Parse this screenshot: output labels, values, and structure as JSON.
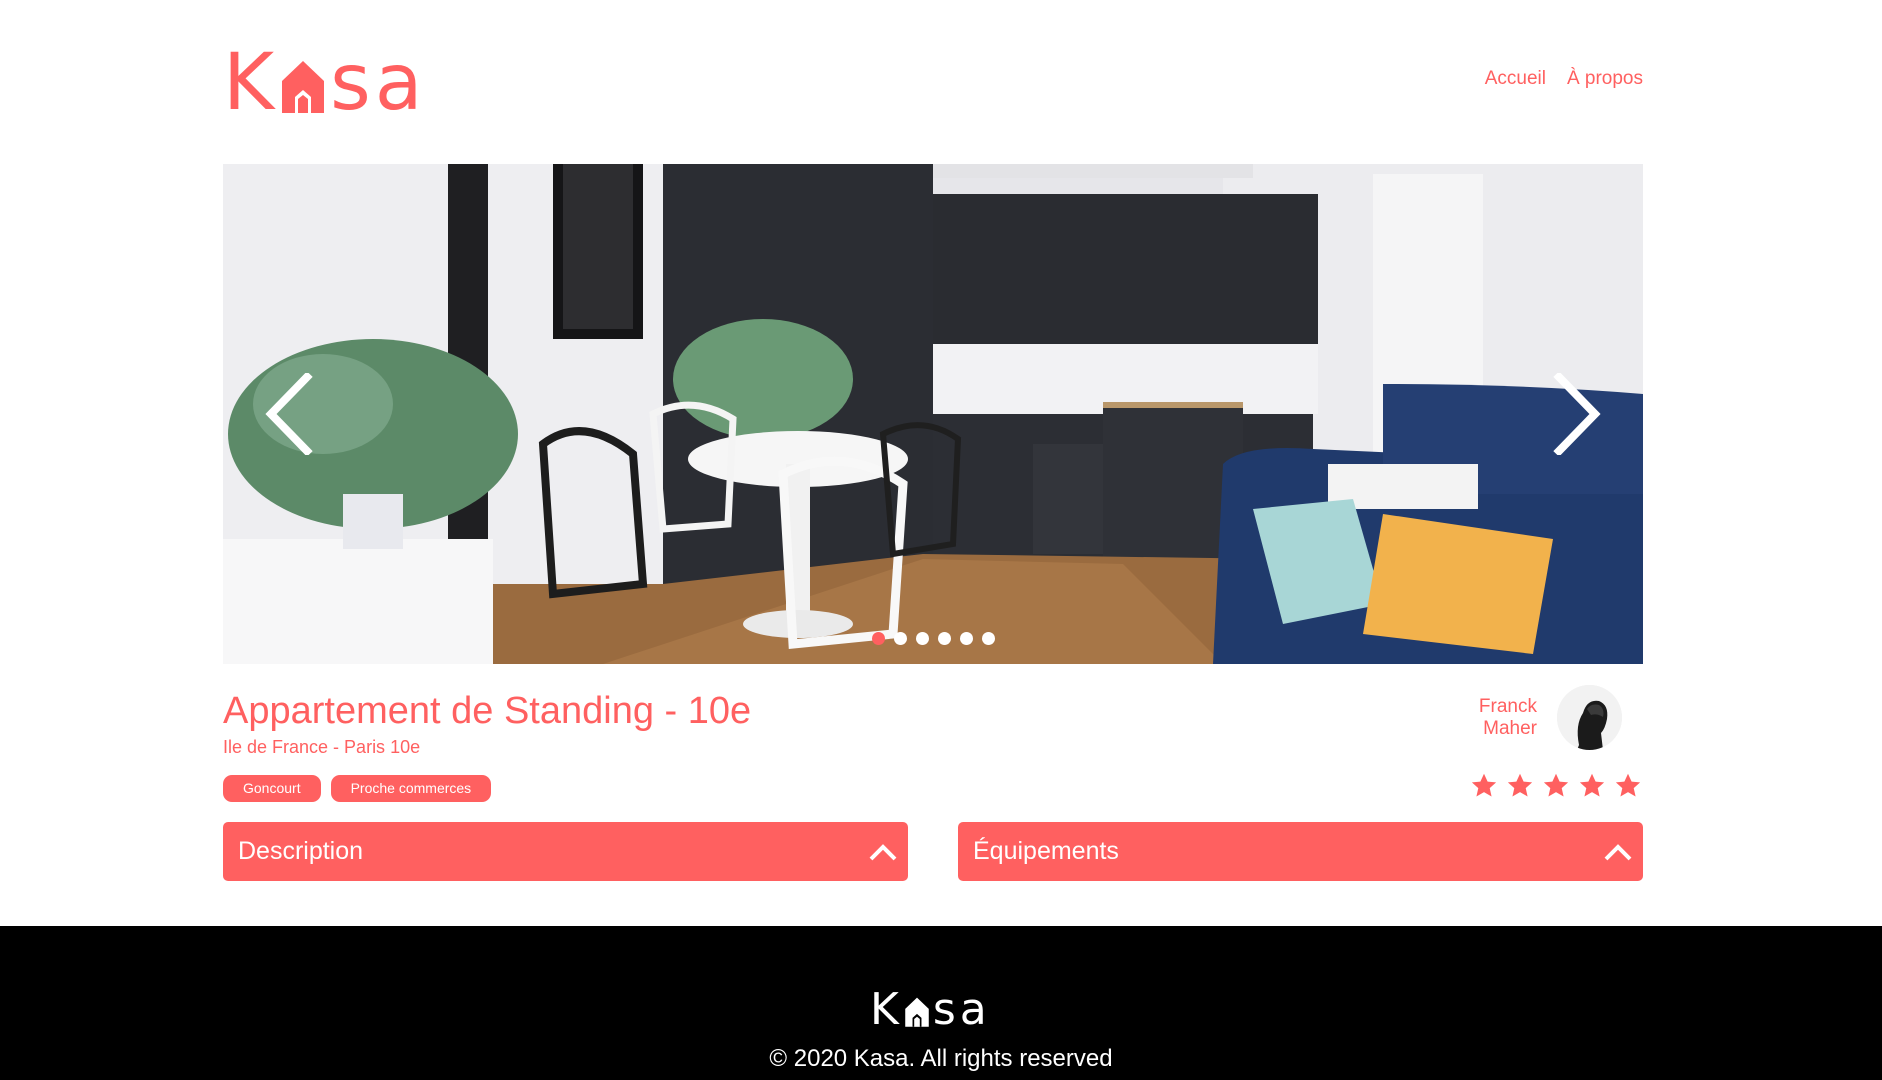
{
  "header": {
    "logo": {
      "part1": "K",
      "part2": "sa"
    },
    "nav": [
      {
        "label": "Accueil"
      },
      {
        "label": "À propos"
      }
    ]
  },
  "slideshow": {
    "slide_count": 6,
    "active_index": 0
  },
  "listing": {
    "title": "Appartement de Standing - 10e",
    "location": "Ile de France - Paris 10e",
    "tags": [
      "Goncourt",
      "Proche commerces"
    ],
    "host": {
      "first_name": "Franck",
      "last_name": "Maher"
    },
    "rating": 5,
    "rating_max": 5
  },
  "collapses": {
    "description": {
      "label": "Description"
    },
    "equipments": {
      "label": "Équipements"
    }
  },
  "footer": {
    "logo": {
      "part1": "K",
      "part2": "sa"
    },
    "copyright": "© 2020 Kasa. All rights reserved"
  },
  "colors": {
    "accent": "#FF6060",
    "footer_bg": "#000000",
    "text_light": "#FFFFFF"
  }
}
